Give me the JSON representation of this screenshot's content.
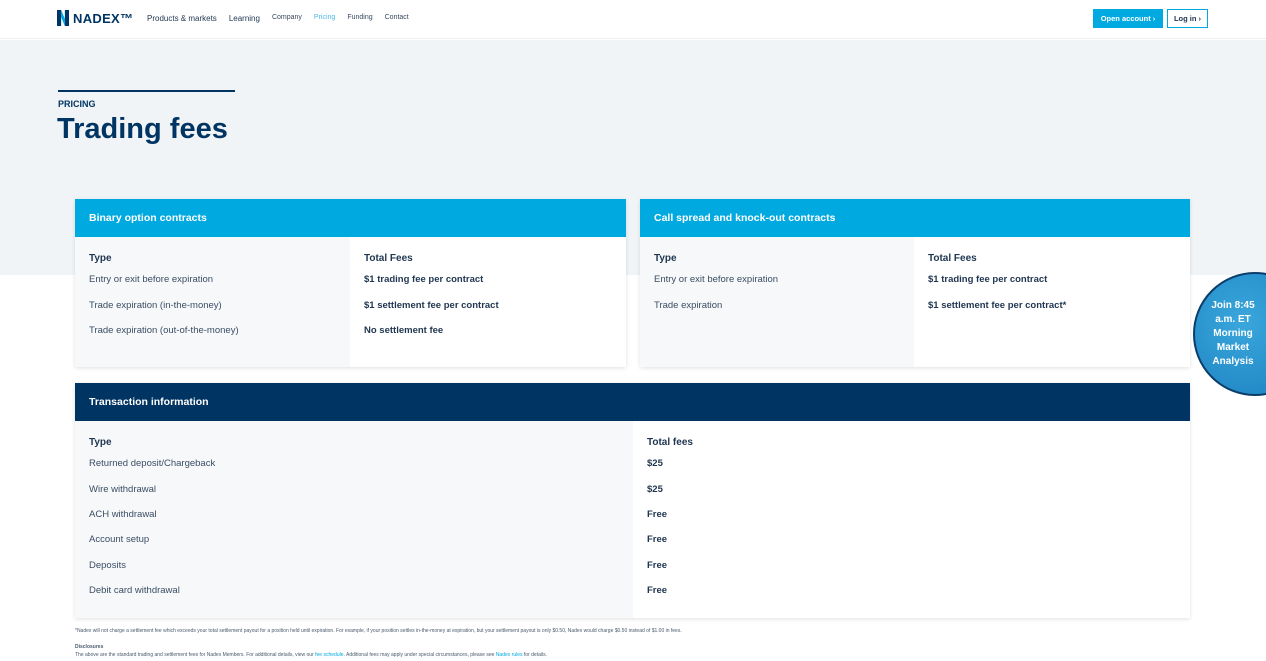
{
  "brand": "NADEX™",
  "nav": [
    "Products & markets",
    "Learning",
    "Company",
    "Pricing",
    "Funding",
    "Contact"
  ],
  "header": {
    "open_account": "Open account ›",
    "login": "Log in ›"
  },
  "hero": {
    "eyebrow": "PRICING",
    "title": "Trading fees"
  },
  "binary": {
    "title": "Binary option contracts",
    "col_type": "Type",
    "col_fees": "Total Fees",
    "rows": [
      {
        "type": "Entry or exit before expiration",
        "fee": "$1 trading fee per contract"
      },
      {
        "type": "Trade expiration (in-the-money)",
        "fee": "$1 settlement fee per contract"
      },
      {
        "type": "Trade expiration (out-of-the-money)",
        "fee": "No settlement fee"
      }
    ]
  },
  "spread": {
    "title": "Call spread and knock-out contracts",
    "col_type": "Type",
    "col_fees": "Total Fees",
    "rows": [
      {
        "type": "Entry or exit before expiration",
        "fee": "$1 trading fee per contract"
      },
      {
        "type": "Trade expiration",
        "fee": "$1 settlement fee per contract*"
      }
    ]
  },
  "transaction": {
    "title": "Transaction information",
    "col_type": "Type",
    "col_fees": "Total fees",
    "rows": [
      {
        "type": "Returned deposit/Chargeback",
        "fee": "$25"
      },
      {
        "type": "Wire withdrawal",
        "fee": "$25"
      },
      {
        "type": "ACH withdrawal",
        "fee": "Free"
      },
      {
        "type": "Account setup",
        "fee": "Free"
      },
      {
        "type": "Deposits",
        "fee": "Free"
      },
      {
        "type": "Debit card withdrawal",
        "fee": "Free"
      }
    ]
  },
  "footnote": "*Nadex will not charge a settlement fee which exceeds your total settlement payout for a position held until expiration. For example, if your position settles in-the-money at expiration, but your settlement payout is only $0.50, Nadex would charge $0.50 instead of $1.00 in fees.",
  "disclosures": {
    "title": "Disclosures",
    "text1": "The above are the standard trading and settlement fees for Nadex Members. For additional details, view our ",
    "link1": "fee schedule",
    "text2": ". Additional fees may apply under special circumstances, please see ",
    "link2": "Nadex rules",
    "text3": " for details."
  },
  "promo": [
    "Join 8:45",
    "a.m. ET",
    "Morning",
    "Market",
    "Analysis"
  ]
}
